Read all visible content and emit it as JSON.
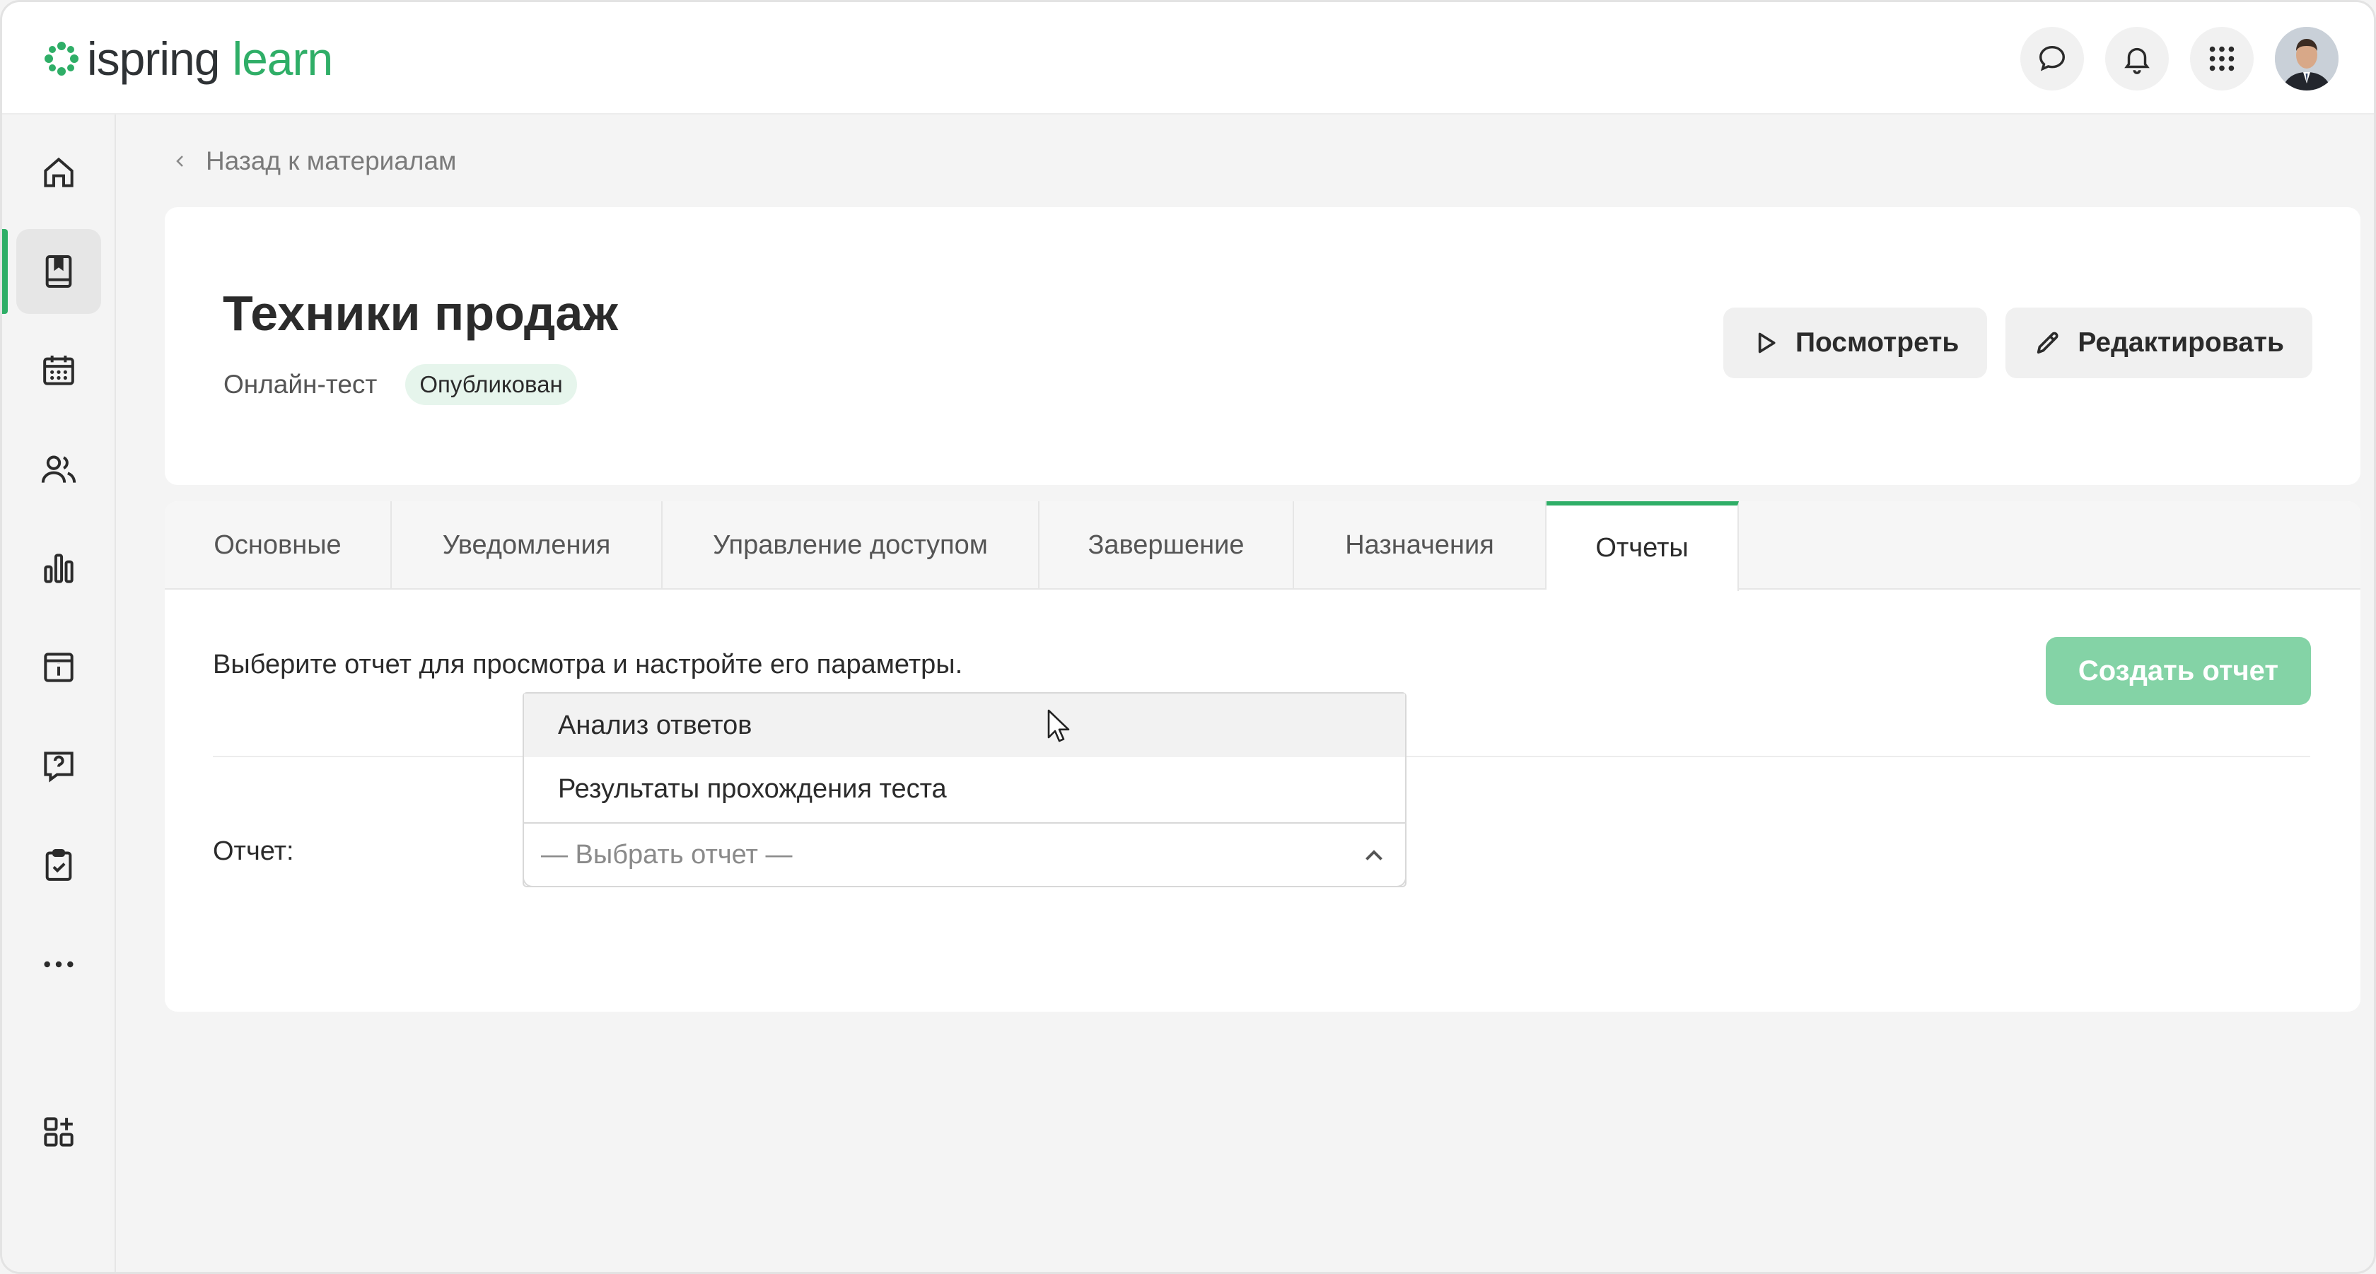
{
  "app": {
    "logo_word1": "ispring",
    "logo_word2": "learn",
    "brand_color": "#2fae67"
  },
  "header": {
    "icons": [
      "chat-icon",
      "bell-icon",
      "apps-grid-icon",
      "user-avatar"
    ]
  },
  "sidebar": {
    "items": [
      {
        "id": "home",
        "icon": "home-icon",
        "active": false
      },
      {
        "id": "materials",
        "icon": "book-icon",
        "active": true
      },
      {
        "id": "calendar",
        "icon": "calendar-icon",
        "active": false
      },
      {
        "id": "users",
        "icon": "users-icon",
        "active": false
      },
      {
        "id": "reports",
        "icon": "bar-chart-icon",
        "active": false
      },
      {
        "id": "info",
        "icon": "info-board-icon",
        "active": false
      },
      {
        "id": "help",
        "icon": "question-bubble-icon",
        "active": false
      },
      {
        "id": "tasks",
        "icon": "clipboard-check-icon",
        "active": false
      },
      {
        "id": "more",
        "icon": "more-dots-icon",
        "active": false
      },
      {
        "id": "add-widget",
        "icon": "add-widget-icon",
        "active": false
      }
    ]
  },
  "breadcrumb": {
    "back_label": "Назад к материалам"
  },
  "course": {
    "title": "Техники продаж",
    "type": "Онлайн-тест",
    "status": "Опубликован",
    "view_label": "Посмотреть",
    "edit_label": "Редактировать"
  },
  "tabs": [
    {
      "label": "Основные",
      "active": false
    },
    {
      "label": "Уведомления",
      "active": false
    },
    {
      "label": "Управление доступом",
      "active": false
    },
    {
      "label": "Завершение",
      "active": false
    },
    {
      "label": "Назначения",
      "active": false
    },
    {
      "label": "Отчеты",
      "active": true
    }
  ],
  "reports": {
    "hint": "Выберите отчет для просмотра и настройте его параметры.",
    "create_label": "Создать отчет",
    "field_label": "Отчет:",
    "select_placeholder": "— Выбрать отчет —",
    "options": [
      "Анализ ответов",
      "Результаты прохождения теста"
    ]
  }
}
